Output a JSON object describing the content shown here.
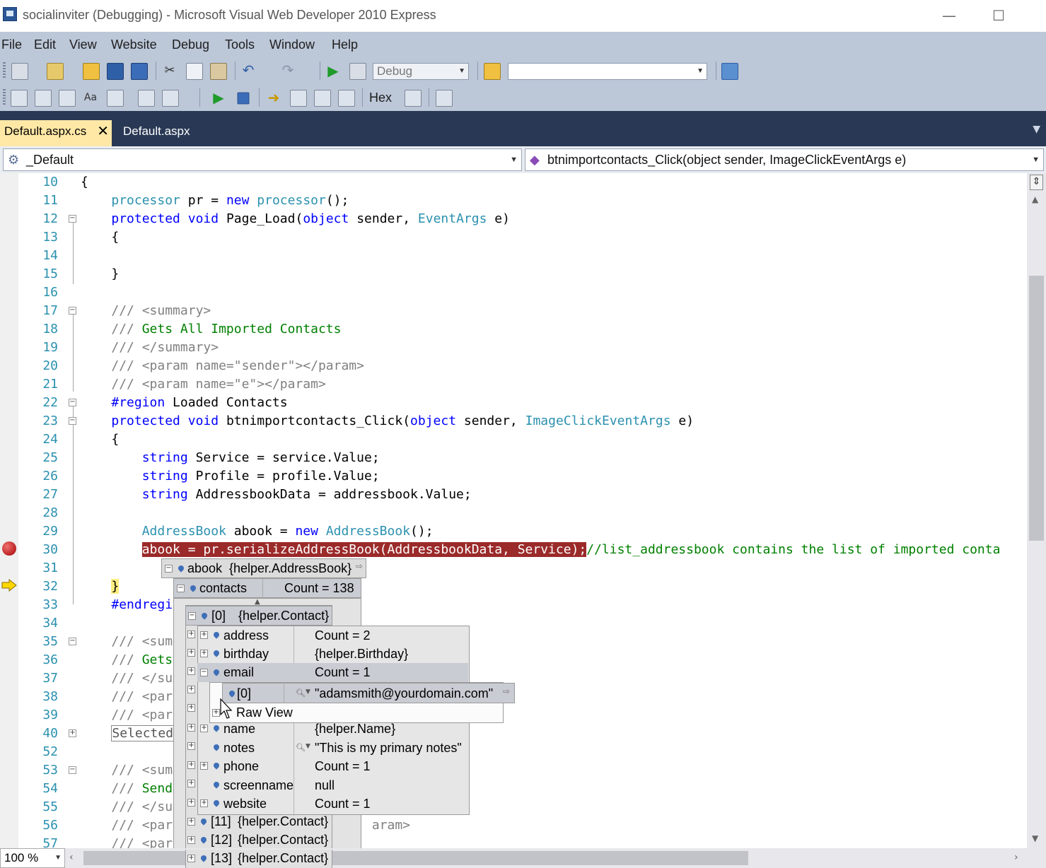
{
  "window": {
    "title": "socialinviter (Debugging) - Microsoft Visual Web Developer 2010 Express",
    "minimize": "—",
    "maximize": "☐"
  },
  "menu": [
    "File",
    "Edit",
    "View",
    "Website",
    "Debug",
    "Tools",
    "Window",
    "Help"
  ],
  "toolbar": {
    "config": "Debug",
    "find_value": "",
    "hex_label": "Hex"
  },
  "tabs": [
    {
      "label": "Default.aspx.cs",
      "active": true,
      "close": "✕"
    },
    {
      "label": "Default.aspx",
      "active": false
    }
  ],
  "nav": {
    "class": "_Default",
    "member": "btnimportcontacts_Click(object sender, ImageClickEventArgs e)"
  },
  "code_lines": [
    {
      "n": "10",
      "text": "{"
    },
    {
      "n": "11",
      "text": "    processor pr = new processor();"
    },
    {
      "n": "12",
      "text": "    protected void Page_Load(object sender, EventArgs e)"
    },
    {
      "n": "13",
      "text": "    {"
    },
    {
      "n": "14",
      "text": ""
    },
    {
      "n": "15",
      "text": "    }"
    },
    {
      "n": "16",
      "text": ""
    },
    {
      "n": "17",
      "text": "    /// <summary>"
    },
    {
      "n": "18",
      "text": "    /// Gets All Imported Contacts"
    },
    {
      "n": "19",
      "text": "    /// </summary>"
    },
    {
      "n": "20",
      "text": "    /// <param name=\"sender\"></param>"
    },
    {
      "n": "21",
      "text": "    /// <param name=\"e\"></param>"
    },
    {
      "n": "22",
      "text": "    #region Loaded Contacts"
    },
    {
      "n": "23",
      "text": "    protected void btnimportcontacts_Click(object sender, ImageClickEventArgs e)"
    },
    {
      "n": "24",
      "text": "    {"
    },
    {
      "n": "25",
      "text": "        string Service = service.Value;"
    },
    {
      "n": "26",
      "text": "        string Profile = profile.Value;"
    },
    {
      "n": "27",
      "text": "        string AddressbookData = addressbook.Value;"
    },
    {
      "n": "28",
      "text": ""
    },
    {
      "n": "29",
      "text": "        AddressBook abook = new AddressBook();"
    },
    {
      "n": "30",
      "text": "        abook = pr.serializeAddressBook(AddressbookData, Service);//list_addressbook contains the list of imported conta"
    },
    {
      "n": "31",
      "text": ""
    },
    {
      "n": "32",
      "text": "    }"
    },
    {
      "n": "33",
      "text": "    #endregi"
    },
    {
      "n": "34",
      "text": ""
    },
    {
      "n": "35",
      "text": "    /// <sum"
    },
    {
      "n": "36",
      "text": "    /// Gets"
    },
    {
      "n": "37",
      "text": "    /// </sum"
    },
    {
      "n": "38",
      "text": "    /// <para"
    },
    {
      "n": "39",
      "text": "    /// <para"
    },
    {
      "n": "40",
      "text": "    Selected"
    },
    {
      "n": "52",
      "text": ""
    },
    {
      "n": "53",
      "text": "    /// <summ"
    },
    {
      "n": "54",
      "text": "    /// Send"
    },
    {
      "n": "55",
      "text": "    /// </sum"
    },
    {
      "n": "56",
      "text": "    /// <para                         aram>"
    },
    {
      "n": "57",
      "text": "    /// <para"
    }
  ],
  "datatip": {
    "root_name": "abook",
    "root_value": "{helper.AddressBook}",
    "contacts_name": "contacts",
    "contacts_value": "Count = 138",
    "item0_name": "[0]",
    "item0_value": "{helper.Contact}",
    "fields": [
      {
        "name": "address",
        "value": "Count = 2"
      },
      {
        "name": "birthday",
        "value": "{helper.Birthday}"
      },
      {
        "name": "email",
        "value": "Count = 1"
      },
      {
        "name": "name",
        "value": "{helper.Name}"
      },
      {
        "name": "notes",
        "value": "\"This is my primary notes\""
      },
      {
        "name": "phone",
        "value": "Count = 1"
      },
      {
        "name": "screenname",
        "value": "null"
      },
      {
        "name": "website",
        "value": "Count = 1"
      }
    ],
    "email_item_name": "[0]",
    "email_item_value": "\"adamsmith@yourdomain.com\"",
    "raw_view": "Raw View",
    "more_items": [
      {
        "name": "[11]",
        "value": "{helper.Contact}"
      },
      {
        "name": "[12]",
        "value": "{helper.Contact}"
      },
      {
        "name": "[13]",
        "value": "{helper.Contact}"
      }
    ]
  },
  "status": {
    "zoom": "100 %"
  }
}
